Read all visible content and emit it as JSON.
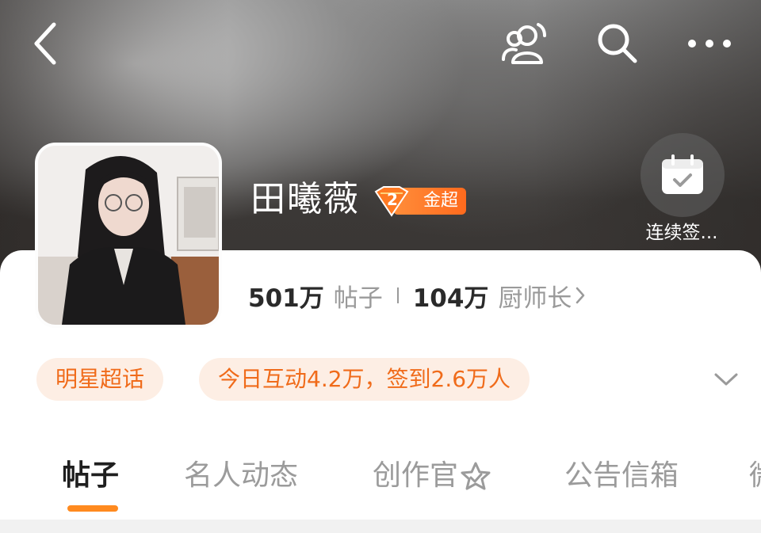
{
  "header": {
    "back_icon": "chevron-left-icon",
    "friends_icon": "friends-icon",
    "search_icon": "search-icon",
    "more_icon": "more-icon"
  },
  "profile": {
    "name": "田曦薇",
    "badge_label": "金超",
    "badge_level": "2",
    "checkin_label": "连续签..."
  },
  "stats": {
    "posts_value": "501万",
    "posts_label": "帖子",
    "followers_value": "104万",
    "followers_label": "厨师长"
  },
  "tags": {
    "category": "明星超话",
    "activity": "今日互动4.2万，签到2.6万人"
  },
  "tabs": [
    {
      "label": "帖子"
    },
    {
      "label": "名人动态"
    },
    {
      "label": "创作官"
    },
    {
      "label": "公告信箱"
    },
    {
      "label": "微"
    }
  ],
  "colors": {
    "accent": "#ff8a1f",
    "tag_bg": "#fdeee4",
    "tag_text": "#f06b1a",
    "badge": "#ff6a1d"
  }
}
